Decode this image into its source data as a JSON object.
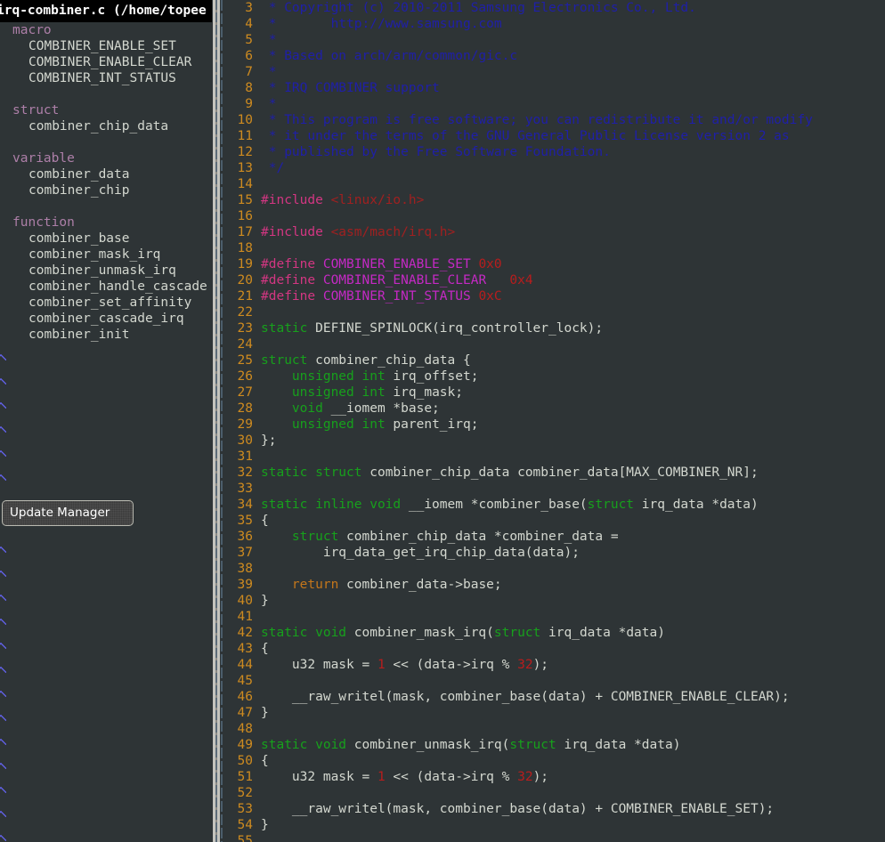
{
  "window": {
    "title": "irq-combiner.c (/home/topee"
  },
  "sidebar": {
    "groups": [
      {
        "category": "macro",
        "items": [
          "COMBINER_ENABLE_SET",
          "COMBINER_ENABLE_CLEAR",
          "COMBINER_INT_STATUS"
        ]
      },
      {
        "category": "struct",
        "items": [
          "combiner_chip_data"
        ]
      },
      {
        "category": "variable",
        "items": [
          "combiner_data",
          "combiner_chip"
        ]
      },
      {
        "category": "function",
        "items": [
          "combiner_base",
          "combiner_mask_irq",
          "combiner_unmask_irq",
          "combiner_handle_cascade",
          "combiner_set_affinity",
          "combiner_cascade_irq",
          "combiner_init"
        ]
      }
    ]
  },
  "tooltip": {
    "label": "Update Manager"
  },
  "editor": {
    "first_line": 3,
    "lines": [
      {
        "n": 3,
        "parts": [
          {
            "t": " * Copyright (c) 2010-2011 Samsung Electronics Co., Ltd.",
            "c": "cmt"
          }
        ]
      },
      {
        "n": 4,
        "parts": [
          {
            "t": " *       http://www.samsung.com",
            "c": "cmt"
          }
        ]
      },
      {
        "n": 5,
        "parts": [
          {
            "t": " *",
            "c": "cmt"
          }
        ]
      },
      {
        "n": 6,
        "parts": [
          {
            "t": " * Based on arch/arm/common/gic.c",
            "c": "cmt"
          }
        ]
      },
      {
        "n": 7,
        "parts": [
          {
            "t": " *",
            "c": "cmt"
          }
        ]
      },
      {
        "n": 8,
        "parts": [
          {
            "t": " * IRQ COMBINER support",
            "c": "cmt"
          }
        ]
      },
      {
        "n": 9,
        "parts": [
          {
            "t": " *",
            "c": "cmt"
          }
        ]
      },
      {
        "n": 10,
        "parts": [
          {
            "t": " * This program is free software; you can redistribute it and/or modify",
            "c": "cmt"
          }
        ]
      },
      {
        "n": 11,
        "parts": [
          {
            "t": " * it under the terms of the GNU General Public License version 2 as",
            "c": "cmt"
          }
        ]
      },
      {
        "n": 12,
        "parts": [
          {
            "t": " * published by the Free Software Foundation.",
            "c": "cmt"
          }
        ]
      },
      {
        "n": 13,
        "parts": [
          {
            "t": " */",
            "c": "cmt"
          }
        ]
      },
      {
        "n": 14,
        "parts": []
      },
      {
        "n": 15,
        "parts": [
          {
            "t": "#include ",
            "c": "pre"
          },
          {
            "t": "<linux/io.h>",
            "c": "inc"
          }
        ]
      },
      {
        "n": 16,
        "parts": []
      },
      {
        "n": 17,
        "parts": [
          {
            "t": "#include ",
            "c": "pre"
          },
          {
            "t": "<asm/mach/irq.h>",
            "c": "inc"
          }
        ]
      },
      {
        "n": 18,
        "parts": []
      },
      {
        "n": 19,
        "parts": [
          {
            "t": "#define ",
            "c": "pre"
          },
          {
            "t": "COMBINER_ENABLE_SET ",
            "c": "mac"
          },
          {
            "t": "0x0",
            "c": "num"
          }
        ]
      },
      {
        "n": 20,
        "parts": [
          {
            "t": "#define ",
            "c": "pre"
          },
          {
            "t": "COMBINER_ENABLE_CLEAR   ",
            "c": "mac"
          },
          {
            "t": "0x4",
            "c": "num"
          }
        ]
      },
      {
        "n": 21,
        "parts": [
          {
            "t": "#define ",
            "c": "pre"
          },
          {
            "t": "COMBINER_INT_STATUS ",
            "c": "mac"
          },
          {
            "t": "0xC",
            "c": "num"
          }
        ]
      },
      {
        "n": 22,
        "parts": []
      },
      {
        "n": 23,
        "parts": [
          {
            "t": "static",
            "c": "kw"
          },
          {
            "t": " DEFINE_SPINLOCK(irq_controller_lock);",
            "c": "code"
          }
        ]
      },
      {
        "n": 24,
        "parts": []
      },
      {
        "n": 25,
        "parts": [
          {
            "t": "struct",
            "c": "kw"
          },
          {
            "t": " combiner_chip_data {",
            "c": "code"
          }
        ]
      },
      {
        "n": 26,
        "parts": [
          {
            "t": "    ",
            "c": "code"
          },
          {
            "t": "unsigned int",
            "c": "kw"
          },
          {
            "t": " irq_offset;",
            "c": "code"
          }
        ]
      },
      {
        "n": 27,
        "parts": [
          {
            "t": "    ",
            "c": "code"
          },
          {
            "t": "unsigned int",
            "c": "kw"
          },
          {
            "t": " irq_mask;",
            "c": "code"
          }
        ]
      },
      {
        "n": 28,
        "parts": [
          {
            "t": "    ",
            "c": "code"
          },
          {
            "t": "void",
            "c": "kw"
          },
          {
            "t": " __iomem *base;",
            "c": "code"
          }
        ]
      },
      {
        "n": 29,
        "parts": [
          {
            "t": "    ",
            "c": "code"
          },
          {
            "t": "unsigned int",
            "c": "kw"
          },
          {
            "t": " parent_irq;",
            "c": "code"
          }
        ]
      },
      {
        "n": 30,
        "parts": [
          {
            "t": "};",
            "c": "code"
          }
        ]
      },
      {
        "n": 31,
        "parts": []
      },
      {
        "n": 32,
        "parts": [
          {
            "t": "static struct",
            "c": "kw"
          },
          {
            "t": " combiner_chip_data combiner_data[MAX_COMBINER_NR];",
            "c": "code"
          }
        ]
      },
      {
        "n": 33,
        "parts": []
      },
      {
        "n": 34,
        "parts": [
          {
            "t": "static inline void",
            "c": "kw"
          },
          {
            "t": " __iomem *combiner_base(",
            "c": "code"
          },
          {
            "t": "struct",
            "c": "kw"
          },
          {
            "t": " irq_data *data)",
            "c": "code"
          }
        ]
      },
      {
        "n": 35,
        "parts": [
          {
            "t": "{",
            "c": "code"
          }
        ]
      },
      {
        "n": 36,
        "parts": [
          {
            "t": "    ",
            "c": "code"
          },
          {
            "t": "struct",
            "c": "kw"
          },
          {
            "t": " combiner_chip_data *combiner_data =",
            "c": "code"
          }
        ]
      },
      {
        "n": 37,
        "parts": [
          {
            "t": "        irq_data_get_irq_chip_data(data);",
            "c": "code"
          }
        ]
      },
      {
        "n": 38,
        "parts": []
      },
      {
        "n": 39,
        "parts": [
          {
            "t": "    ",
            "c": "code"
          },
          {
            "t": "return",
            "c": "ret"
          },
          {
            "t": " combiner_data->base;",
            "c": "code"
          }
        ]
      },
      {
        "n": 40,
        "parts": [
          {
            "t": "}",
            "c": "code"
          }
        ]
      },
      {
        "n": 41,
        "parts": []
      },
      {
        "n": 42,
        "parts": [
          {
            "t": "static void",
            "c": "kw"
          },
          {
            "t": " combiner_mask_irq(",
            "c": "code"
          },
          {
            "t": "struct",
            "c": "kw"
          },
          {
            "t": " irq_data *data)",
            "c": "code"
          }
        ]
      },
      {
        "n": 43,
        "parts": [
          {
            "t": "{",
            "c": "code"
          }
        ]
      },
      {
        "n": 44,
        "parts": [
          {
            "t": "    u32 mask = ",
            "c": "code"
          },
          {
            "t": "1",
            "c": "num"
          },
          {
            "t": " << (data->irq % ",
            "c": "code"
          },
          {
            "t": "32",
            "c": "num"
          },
          {
            "t": ");",
            "c": "code"
          }
        ]
      },
      {
        "n": 45,
        "parts": []
      },
      {
        "n": 46,
        "parts": [
          {
            "t": "    __raw_writel(mask, combiner_base(data) + COMBINER_ENABLE_CLEAR);",
            "c": "code"
          }
        ]
      },
      {
        "n": 47,
        "parts": [
          {
            "t": "}",
            "c": "code"
          }
        ]
      },
      {
        "n": 48,
        "parts": []
      },
      {
        "n": 49,
        "parts": [
          {
            "t": "static void",
            "c": "kw"
          },
          {
            "t": " combiner_unmask_irq(",
            "c": "code"
          },
          {
            "t": "struct",
            "c": "kw"
          },
          {
            "t": " irq_data *data)",
            "c": "code"
          }
        ]
      },
      {
        "n": 50,
        "parts": [
          {
            "t": "{",
            "c": "code"
          }
        ]
      },
      {
        "n": 51,
        "parts": [
          {
            "t": "    u32 mask = ",
            "c": "code"
          },
          {
            "t": "1",
            "c": "num"
          },
          {
            "t": " << (data->irq % ",
            "c": "code"
          },
          {
            "t": "32",
            "c": "num"
          },
          {
            "t": ");",
            "c": "code"
          }
        ]
      },
      {
        "n": 52,
        "parts": []
      },
      {
        "n": 53,
        "parts": [
          {
            "t": "    __raw_writel(mask, combiner_base(data) + COMBINER_ENABLE_SET);",
            "c": "code"
          }
        ]
      },
      {
        "n": 54,
        "parts": [
          {
            "t": "}",
            "c": "code"
          }
        ]
      },
      {
        "n": 55,
        "parts": []
      }
    ]
  },
  "colors": {
    "background": "#2e3436",
    "linenumber": "#ce8b20",
    "comment": "#1f1fa8",
    "keyword": "#17a01c",
    "preproc": "#d33682",
    "macro": "#c429c4",
    "number": "#b81d1d",
    "include_path": "#a02020",
    "return_keyword": "#c4761b",
    "symbol_category": "#ad7fa8",
    "symbol_item": "#d3d7cf",
    "titlebar_bg": "#000000"
  }
}
